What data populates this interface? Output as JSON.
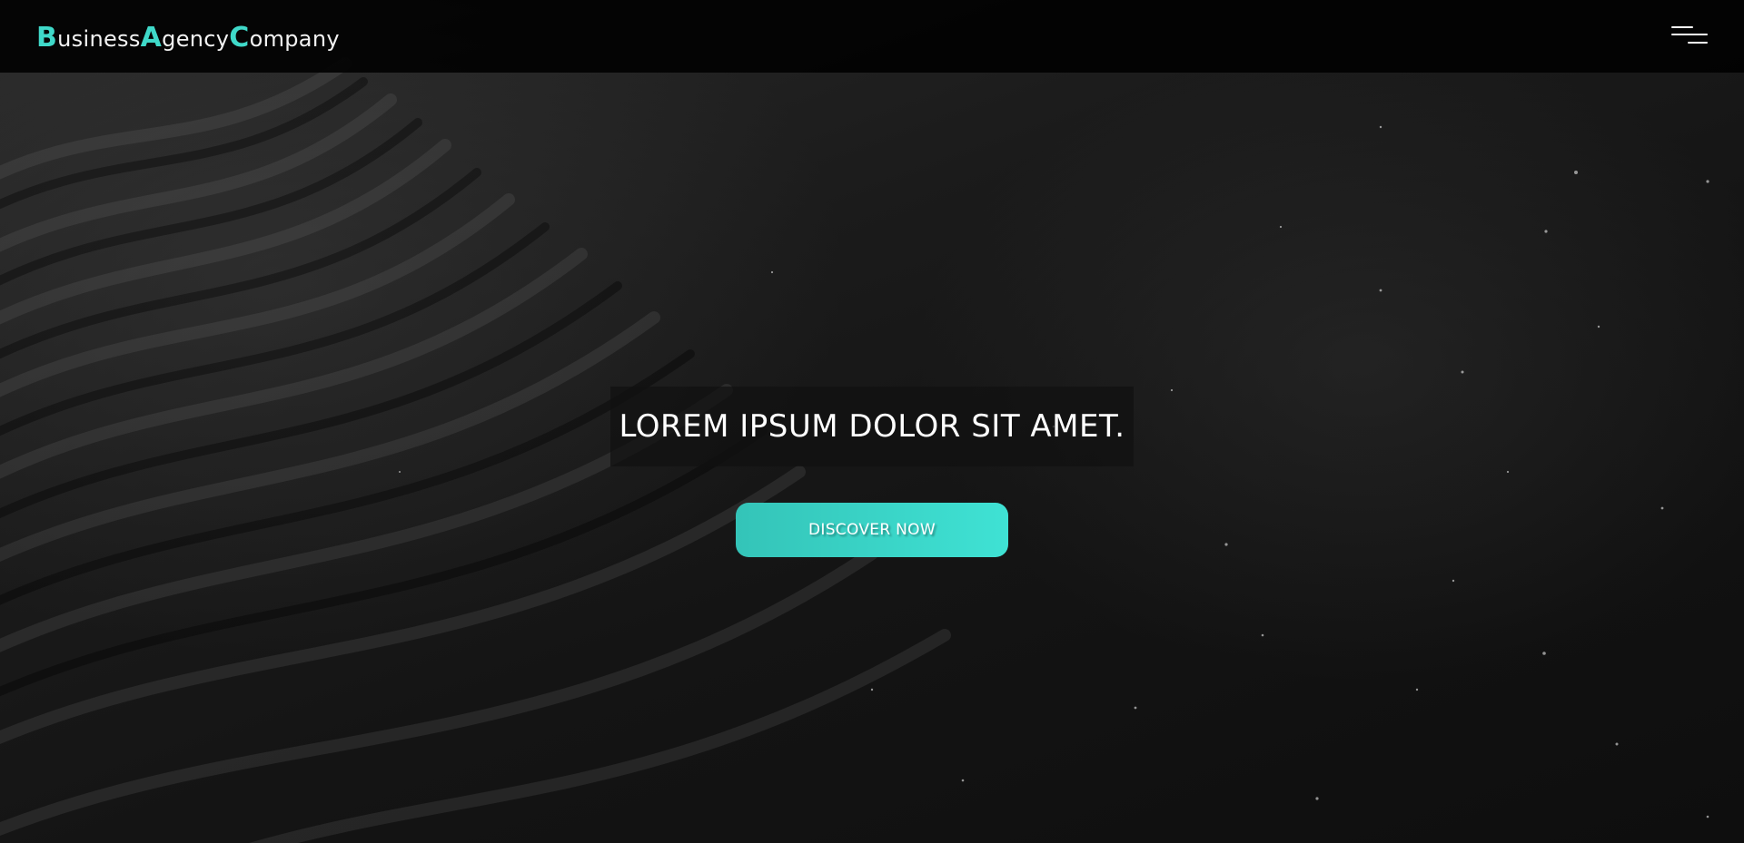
{
  "header": {
    "logo": {
      "part1_cap": "B",
      "part1_rest": "usiness",
      "part2_cap": "A",
      "part2_rest": "gency",
      "part3_cap": "C",
      "part3_rest": "ompany"
    },
    "menu_icon": "hamburger-menu-icon"
  },
  "hero": {
    "headline": "LOREM IPSUM DOLOR SIT AMET.",
    "cta_label": "DISCOVER NOW"
  },
  "colors": {
    "accent": "#3fd9c9",
    "header_bg": "#000000",
    "text": "#ffffff"
  }
}
